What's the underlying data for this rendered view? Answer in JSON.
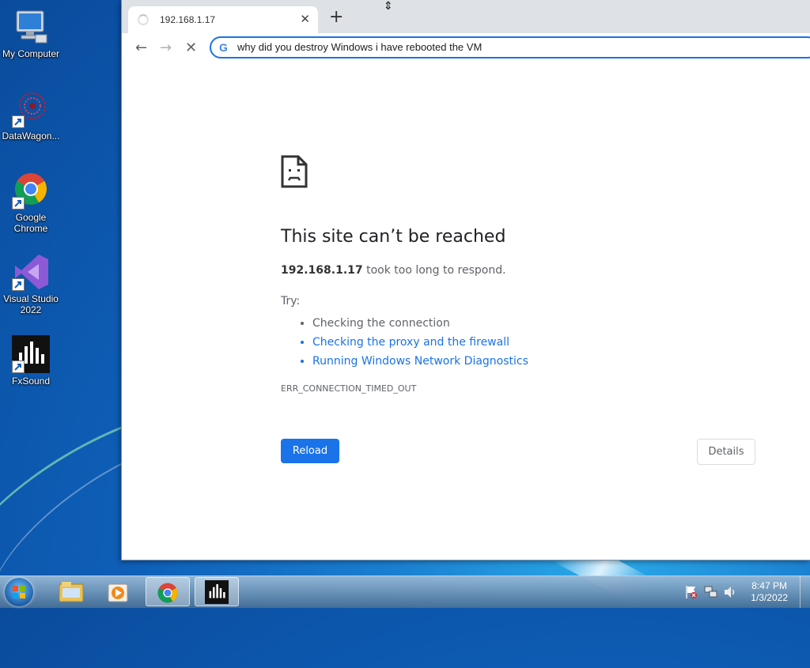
{
  "desktop": {
    "icons": [
      {
        "label": "My Computer"
      },
      {
        "label": "DataWagon..."
      },
      {
        "label": "Google Chrome"
      },
      {
        "label": "Visual Studio 2022"
      },
      {
        "label": "FxSound"
      }
    ]
  },
  "browser": {
    "tab": {
      "title": "192.168.1.17",
      "close": "✕"
    },
    "new_tab": "+",
    "nav": {
      "back": "←",
      "forward": "→",
      "stop": "✕"
    },
    "omnibox": {
      "google": "G",
      "query": "why did you destroy Windows i have rebooted the VM"
    },
    "error": {
      "heading": "This site can’t be reached",
      "host": "192.168.1.17",
      "message": " took too long to respond.",
      "try_label": "Try:",
      "suggestions": [
        "Checking the connection",
        "Checking the proxy and the firewall",
        "Running Windows Network Diagnostics"
      ],
      "code": "ERR_CONNECTION_TIMED_OUT",
      "reload": "Reload",
      "details": "Details"
    }
  },
  "taskbar": {
    "clock": {
      "time": "8:47 PM",
      "date": "1/3/2022"
    }
  },
  "colors": {
    "accent": "#1a73e8",
    "link": "#1a73e8"
  }
}
